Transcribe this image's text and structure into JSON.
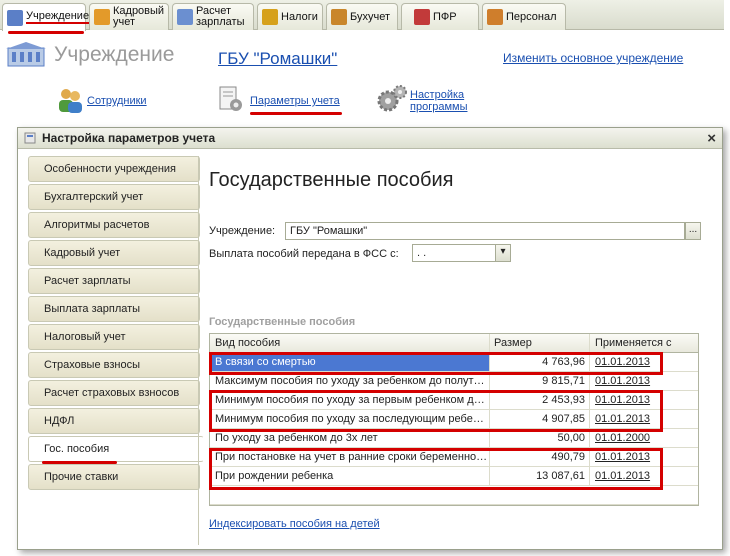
{
  "tabs": [
    {
      "label": "Учреждение",
      "active": true,
      "icon": "building-icon",
      "color": "#5b7fc7"
    },
    {
      "label": "Кадровый учет",
      "active": false,
      "icon": "people-icon",
      "color": "#e39a2a"
    },
    {
      "label": "Расчет зарплаты",
      "active": false,
      "icon": "payroll-icon",
      "color": "#6b8fd0"
    },
    {
      "label": "Налоги",
      "active": false,
      "icon": "taxes-icon",
      "color": "#d6a11c"
    },
    {
      "label": "Бухучет",
      "active": false,
      "icon": "accountant-icon",
      "color": "#c9862b"
    },
    {
      "label": "ПФР",
      "active": false,
      "icon": "pfr-icon",
      "color": "#c23a3a"
    },
    {
      "label": "Персонал",
      "active": false,
      "icon": "staff-icon",
      "color": "#cf7e2c"
    }
  ],
  "header": {
    "title": "Учреждение",
    "organization": "ГБУ \"Ромашки\"",
    "change_link": "Изменить основное учреждение"
  },
  "quick_links": {
    "employees": "Сотрудники",
    "accounting_params": "Параметры учета",
    "program_settings_line1": "Настройка",
    "program_settings_line2": "программы"
  },
  "dialog": {
    "title": "Настройка параметров учета",
    "close": "×",
    "nav": [
      {
        "label": "Особенности учреждения"
      },
      {
        "label": "Бухгалтерский учет"
      },
      {
        "label": "Алгоритмы расчетов"
      },
      {
        "label": "Кадровый учет"
      },
      {
        "label": "Расчет зарплаты"
      },
      {
        "label": "Выплата зарплаты"
      },
      {
        "label": "Налоговый учет"
      },
      {
        "label": "Страховые взносы"
      },
      {
        "label": "Расчет страховых взносов"
      },
      {
        "label": "НДФЛ"
      },
      {
        "label": "Гос. пособия",
        "active": true
      },
      {
        "label": "Прочие ставки"
      }
    ],
    "content": {
      "page_title": "Государственные пособия",
      "institution_label": "Учреждение:",
      "institution_value": "ГБУ \"Ромашки\"",
      "institution_btn": "...",
      "fss_label": "Выплата пособий передана в ФСС с:",
      "fss_value": " .  .",
      "section_title": "Государственные пособия",
      "table": {
        "headers": [
          "Вид пособия",
          "Размер",
          "Применяется с"
        ],
        "rows": [
          [
            "В связи со смертью",
            "4 763,96",
            "01.01.2013"
          ],
          [
            "Максимум пособия по уходу за ребенком до полутора лет",
            "9 815,71",
            "01.01.2013"
          ],
          [
            "Минимум пособия по уходу за первым ребенком до полутора лет",
            "2 453,93",
            "01.01.2013"
          ],
          [
            "Минимум пособия по уходу за последующим ребенком до полутора лет",
            "4 907,85",
            "01.01.2013"
          ],
          [
            "По уходу за ребенком до 3х лет",
            "50,00",
            "01.01.2000"
          ],
          [
            "При постановке на учет в ранние сроки беременности",
            "490,79",
            "01.01.2013"
          ],
          [
            "При рождении ребенка",
            "13 087,61",
            "01.01.2013"
          ]
        ]
      },
      "index_link": "Индексировать пособия на детей"
    }
  }
}
